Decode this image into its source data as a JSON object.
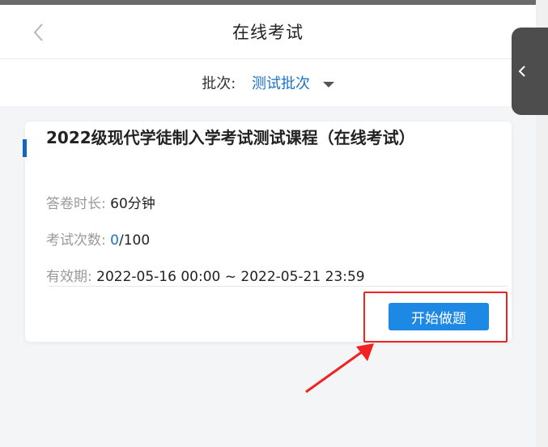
{
  "header": {
    "title": "在线考试"
  },
  "batch": {
    "label": "批次:",
    "selected": "测试批次"
  },
  "course": {
    "title": "2022级现代学徒制入学考试测试课程（在线考试）",
    "duration_label": "答卷时长:",
    "duration_value": "60分钟",
    "attempts_label": "考试次数:",
    "attempts_used": "0",
    "attempts_total": "/100",
    "validity_label": "有效期:",
    "validity_value": "2022-05-16 00:00 ~ 2022-05-21 23:59",
    "start_label": "开始做题"
  },
  "icons": {
    "back": "chevron-left-icon",
    "side_tab": "chevron-left-icon"
  },
  "colors": {
    "accent": "#1a73c9",
    "button": "#1e88e5",
    "highlight": "#f02222"
  }
}
